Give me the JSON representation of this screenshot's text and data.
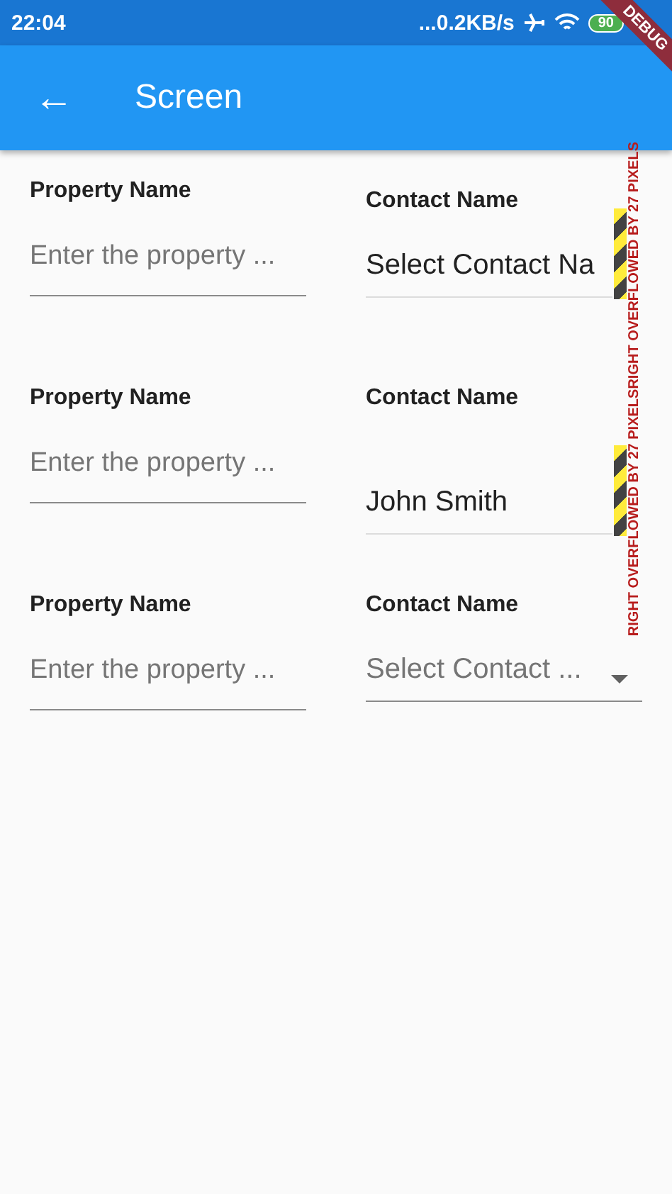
{
  "status_bar": {
    "time": "22:04",
    "network_speed": "...0.2KB/s",
    "battery": "90"
  },
  "app_bar": {
    "back_icon": "←",
    "title": "Screen"
  },
  "debug_banner": "DEBUG",
  "rows": [
    {
      "property": {
        "label": "Property Name",
        "placeholder": "Enter the property ..."
      },
      "contact": {
        "kind": "overflow",
        "label": "Contact Name",
        "value": "Select Contact Na"
      }
    },
    {
      "property": {
        "label": "Property Name",
        "placeholder": "Enter the property ..."
      },
      "contact": {
        "kind": "overflow",
        "label": "Contact Name",
        "value": "John Smith"
      }
    },
    {
      "property": {
        "label": "Property Name",
        "placeholder": "Enter the property ..."
      },
      "contact": {
        "kind": "dropdown",
        "label": "Contact Name",
        "placeholder": "Select Contact ..."
      }
    }
  ],
  "overflow_warning": "RIGHT OVERFLOWED BY 27 PIXELSRIGHT OVERFLOWED BY 27 PIXELS"
}
